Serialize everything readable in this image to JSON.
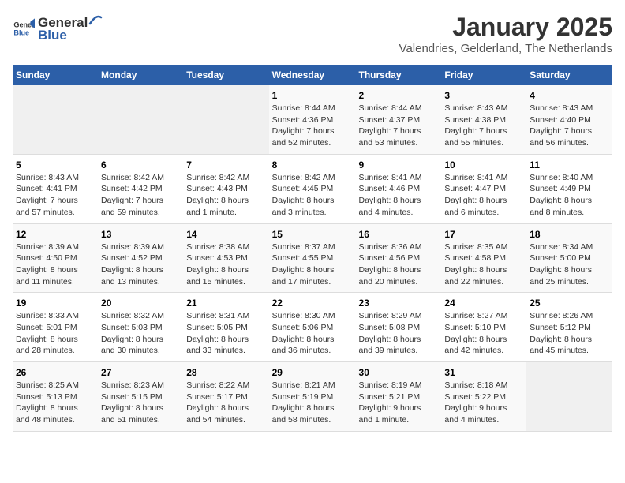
{
  "logo": {
    "text_general": "General",
    "text_blue": "Blue"
  },
  "title": "January 2025",
  "subtitle": "Valendries, Gelderland, The Netherlands",
  "days_of_week": [
    "Sunday",
    "Monday",
    "Tuesday",
    "Wednesday",
    "Thursday",
    "Friday",
    "Saturday"
  ],
  "weeks": [
    [
      {
        "day": "",
        "info": ""
      },
      {
        "day": "",
        "info": ""
      },
      {
        "day": "",
        "info": ""
      },
      {
        "day": "1",
        "info": "Sunrise: 8:44 AM\nSunset: 4:36 PM\nDaylight: 7 hours\nand 52 minutes."
      },
      {
        "day": "2",
        "info": "Sunrise: 8:44 AM\nSunset: 4:37 PM\nDaylight: 7 hours\nand 53 minutes."
      },
      {
        "day": "3",
        "info": "Sunrise: 8:43 AM\nSunset: 4:38 PM\nDaylight: 7 hours\nand 55 minutes."
      },
      {
        "day": "4",
        "info": "Sunrise: 8:43 AM\nSunset: 4:40 PM\nDaylight: 7 hours\nand 56 minutes."
      }
    ],
    [
      {
        "day": "5",
        "info": "Sunrise: 8:43 AM\nSunset: 4:41 PM\nDaylight: 7 hours\nand 57 minutes."
      },
      {
        "day": "6",
        "info": "Sunrise: 8:42 AM\nSunset: 4:42 PM\nDaylight: 7 hours\nand 59 minutes."
      },
      {
        "day": "7",
        "info": "Sunrise: 8:42 AM\nSunset: 4:43 PM\nDaylight: 8 hours\nand 1 minute."
      },
      {
        "day": "8",
        "info": "Sunrise: 8:42 AM\nSunset: 4:45 PM\nDaylight: 8 hours\nand 3 minutes."
      },
      {
        "day": "9",
        "info": "Sunrise: 8:41 AM\nSunset: 4:46 PM\nDaylight: 8 hours\nand 4 minutes."
      },
      {
        "day": "10",
        "info": "Sunrise: 8:41 AM\nSunset: 4:47 PM\nDaylight: 8 hours\nand 6 minutes."
      },
      {
        "day": "11",
        "info": "Sunrise: 8:40 AM\nSunset: 4:49 PM\nDaylight: 8 hours\nand 8 minutes."
      }
    ],
    [
      {
        "day": "12",
        "info": "Sunrise: 8:39 AM\nSunset: 4:50 PM\nDaylight: 8 hours\nand 11 minutes."
      },
      {
        "day": "13",
        "info": "Sunrise: 8:39 AM\nSunset: 4:52 PM\nDaylight: 8 hours\nand 13 minutes."
      },
      {
        "day": "14",
        "info": "Sunrise: 8:38 AM\nSunset: 4:53 PM\nDaylight: 8 hours\nand 15 minutes."
      },
      {
        "day": "15",
        "info": "Sunrise: 8:37 AM\nSunset: 4:55 PM\nDaylight: 8 hours\nand 17 minutes."
      },
      {
        "day": "16",
        "info": "Sunrise: 8:36 AM\nSunset: 4:56 PM\nDaylight: 8 hours\nand 20 minutes."
      },
      {
        "day": "17",
        "info": "Sunrise: 8:35 AM\nSunset: 4:58 PM\nDaylight: 8 hours\nand 22 minutes."
      },
      {
        "day": "18",
        "info": "Sunrise: 8:34 AM\nSunset: 5:00 PM\nDaylight: 8 hours\nand 25 minutes."
      }
    ],
    [
      {
        "day": "19",
        "info": "Sunrise: 8:33 AM\nSunset: 5:01 PM\nDaylight: 8 hours\nand 28 minutes."
      },
      {
        "day": "20",
        "info": "Sunrise: 8:32 AM\nSunset: 5:03 PM\nDaylight: 8 hours\nand 30 minutes."
      },
      {
        "day": "21",
        "info": "Sunrise: 8:31 AM\nSunset: 5:05 PM\nDaylight: 8 hours\nand 33 minutes."
      },
      {
        "day": "22",
        "info": "Sunrise: 8:30 AM\nSunset: 5:06 PM\nDaylight: 8 hours\nand 36 minutes."
      },
      {
        "day": "23",
        "info": "Sunrise: 8:29 AM\nSunset: 5:08 PM\nDaylight: 8 hours\nand 39 minutes."
      },
      {
        "day": "24",
        "info": "Sunrise: 8:27 AM\nSunset: 5:10 PM\nDaylight: 8 hours\nand 42 minutes."
      },
      {
        "day": "25",
        "info": "Sunrise: 8:26 AM\nSunset: 5:12 PM\nDaylight: 8 hours\nand 45 minutes."
      }
    ],
    [
      {
        "day": "26",
        "info": "Sunrise: 8:25 AM\nSunset: 5:13 PM\nDaylight: 8 hours\nand 48 minutes."
      },
      {
        "day": "27",
        "info": "Sunrise: 8:23 AM\nSunset: 5:15 PM\nDaylight: 8 hours\nand 51 minutes."
      },
      {
        "day": "28",
        "info": "Sunrise: 8:22 AM\nSunset: 5:17 PM\nDaylight: 8 hours\nand 54 minutes."
      },
      {
        "day": "29",
        "info": "Sunrise: 8:21 AM\nSunset: 5:19 PM\nDaylight: 8 hours\nand 58 minutes."
      },
      {
        "day": "30",
        "info": "Sunrise: 8:19 AM\nSunset: 5:21 PM\nDaylight: 9 hours\nand 1 minute."
      },
      {
        "day": "31",
        "info": "Sunrise: 8:18 AM\nSunset: 5:22 PM\nDaylight: 9 hours\nand 4 minutes."
      },
      {
        "day": "",
        "info": ""
      }
    ]
  ]
}
